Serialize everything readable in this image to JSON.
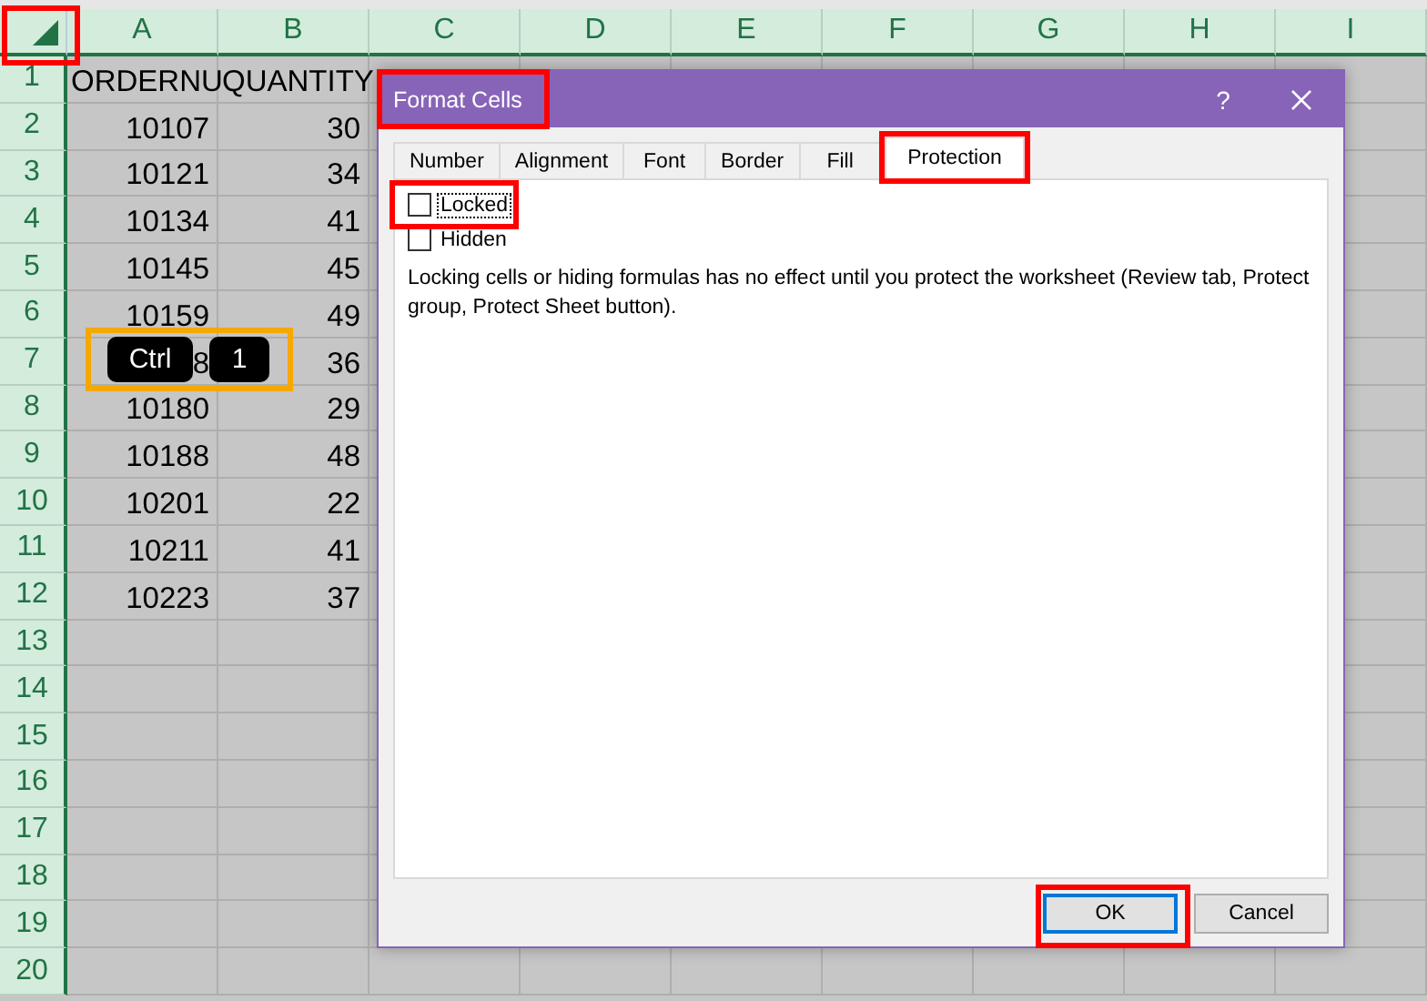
{
  "sheet": {
    "columns": [
      "A",
      "B",
      "C",
      "D",
      "E",
      "F",
      "G",
      "H",
      "I"
    ],
    "rows": [
      {
        "number": "1",
        "kind": "text",
        "cells": [
          "ORDERNU",
          "QUANTITY"
        ]
      },
      {
        "number": "2",
        "kind": "number",
        "cells": [
          "10107",
          "30"
        ]
      },
      {
        "number": "3",
        "kind": "number",
        "cells": [
          "10121",
          "34"
        ]
      },
      {
        "number": "4",
        "kind": "number",
        "cells": [
          "10134",
          "41"
        ]
      },
      {
        "number": "5",
        "kind": "number",
        "cells": [
          "10145",
          "45"
        ]
      },
      {
        "number": "6",
        "kind": "number",
        "cells": [
          "10159",
          "49"
        ]
      },
      {
        "number": "7",
        "kind": "number",
        "cells": [
          "8",
          "36"
        ]
      },
      {
        "number": "8",
        "kind": "number",
        "cells": [
          "10180",
          "29"
        ]
      },
      {
        "number": "9",
        "kind": "number",
        "cells": [
          "10188",
          "48"
        ]
      },
      {
        "number": "10",
        "kind": "number",
        "cells": [
          "10201",
          "22"
        ]
      },
      {
        "number": "11",
        "kind": "number",
        "cells": [
          "10211",
          "41"
        ]
      },
      {
        "number": "12",
        "kind": "number",
        "cells": [
          "10223",
          "37"
        ]
      },
      {
        "number": "13",
        "kind": "number",
        "cells": []
      },
      {
        "number": "14",
        "kind": "number",
        "cells": []
      },
      {
        "number": "15",
        "kind": "number",
        "cells": []
      },
      {
        "number": "16",
        "kind": "number",
        "cells": []
      },
      {
        "number": "17",
        "kind": "number",
        "cells": []
      },
      {
        "number": "18",
        "kind": "number",
        "cells": []
      },
      {
        "number": "19",
        "kind": "number",
        "cells": []
      },
      {
        "number": "20",
        "kind": "number",
        "cells": []
      }
    ]
  },
  "shortcut": {
    "keys": [
      "Ctrl",
      "1"
    ]
  },
  "dialog": {
    "title": "Format Cells",
    "help": "?",
    "tabs": [
      {
        "label": "Number",
        "selected": false
      },
      {
        "label": "Alignment",
        "selected": false
      },
      {
        "label": "Font",
        "selected": false
      },
      {
        "label": "Border",
        "selected": false
      },
      {
        "label": "Fill",
        "selected": false
      },
      {
        "label": "Protection",
        "selected": true
      }
    ],
    "checkboxes": [
      {
        "label": "Locked",
        "checked": false,
        "focused": true
      },
      {
        "label": "Hidden",
        "checked": false,
        "focused": false
      }
    ],
    "note": "Locking cells or hiding formulas has no effect until you protect the worksheet (Review tab, Protect group, Protect Sheet button).",
    "buttons": [
      {
        "label": "OK",
        "default": true
      },
      {
        "label": "Cancel",
        "default": false
      }
    ]
  }
}
